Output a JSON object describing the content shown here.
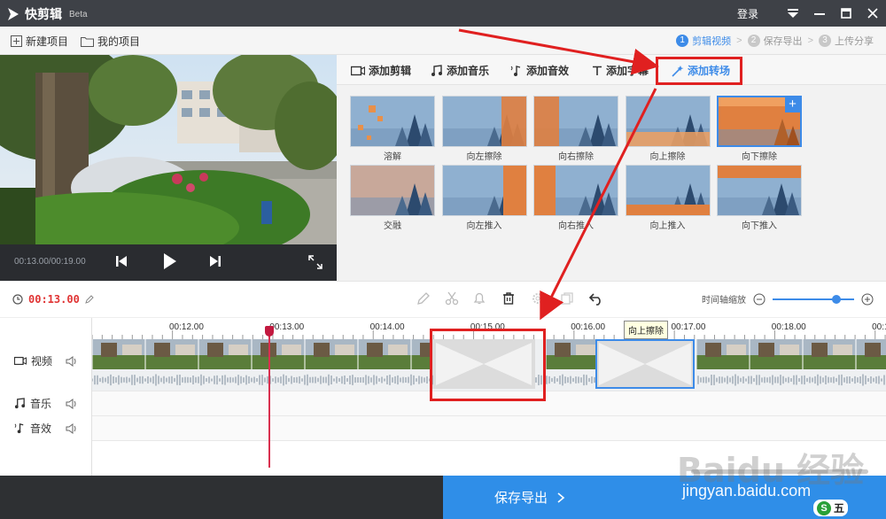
{
  "titlebar": {
    "app_name": "快剪辑",
    "beta": "Beta",
    "login": "登录"
  },
  "toolbar": {
    "new_project": "新建项目",
    "my_projects": "我的项目",
    "steps": [
      {
        "num": "1",
        "label": "剪辑视频",
        "active": true
      },
      {
        "num": "2",
        "label": "保存导出",
        "active": false
      },
      {
        "num": "3",
        "label": "上传分享",
        "active": false
      }
    ]
  },
  "preview": {
    "timecode": "00:13.00/00:19.00"
  },
  "tabs": [
    {
      "label": "添加剪辑",
      "icon": "video-icon"
    },
    {
      "label": "添加音乐",
      "icon": "music-icon"
    },
    {
      "label": "添加音效",
      "icon": "sound-effect-icon"
    },
    {
      "label": "添加字幕",
      "icon": "text-icon"
    },
    {
      "label": "添加转场",
      "icon": "magic-wand-icon",
      "active": true
    }
  ],
  "transitions": [
    {
      "label": "溶解"
    },
    {
      "label": "向左擦除"
    },
    {
      "label": "向右擦除"
    },
    {
      "label": "向上擦除"
    },
    {
      "label": "向下擦除",
      "selected": true
    },
    {
      "label": "交融"
    },
    {
      "label": "向左推入"
    },
    {
      "label": "向右推入"
    },
    {
      "label": "向上推入"
    },
    {
      "label": "向下推入"
    }
  ],
  "timeline": {
    "current_time": "00:13.00",
    "zoom_label": "时间轴缩放",
    "zoom_level": 0.78,
    "ticks": [
      "00:12.00",
      "00:13.00",
      "00:14.00",
      "00:15.00",
      "00:16.00",
      "00:17.00",
      "00:18.00",
      "00:1"
    ],
    "tooltip": "向上擦除",
    "tracks": [
      {
        "label": "视频",
        "icon": "video-icon"
      },
      {
        "label": "音乐",
        "icon": "music-icon"
      },
      {
        "label": "音效",
        "icon": "sound-effect-icon"
      }
    ]
  },
  "footer": {
    "export": "保存导出"
  },
  "watermark": {
    "jingyan": "jingyan.baidu.com",
    "brand": "Baidu 经验",
    "badge": "五"
  },
  "colors": {
    "accent": "#2f8ee8",
    "highlight": "#e02020",
    "titlebar": "#3e4147"
  }
}
